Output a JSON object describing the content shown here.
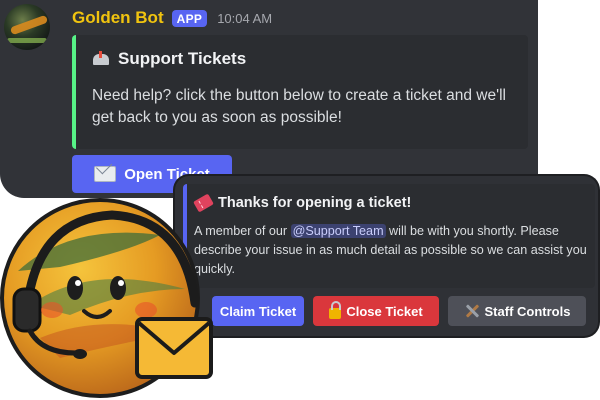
{
  "message": {
    "bot_name": "Golden Bot",
    "badge": "APP",
    "timestamp": "10:04 AM"
  },
  "embed1": {
    "title": "Support Tickets",
    "icon": "mailbox-icon",
    "description": "Need help? click the button below to create a ticket and we'll get back to you as soon as possible!",
    "accent_color": "#57f287"
  },
  "open_ticket_button": {
    "label": "Open Ticket",
    "icon": "envelope-icon",
    "color": "#5865f2"
  },
  "embed2": {
    "title": "Thanks for opening a ticket!",
    "icon": "ticket-icon",
    "desc_prefix": "A member of our ",
    "mention": "@Support Team",
    "desc_suffix": " will be with you shortly. Please describe your issue in as much detail as possible so we can assist you quickly.",
    "accent_color": "#5865f2"
  },
  "buttons": [
    {
      "label": "Claim Ticket",
      "color": "#5865f2"
    },
    {
      "label": "Close Ticket",
      "icon": "lock-icon",
      "color": "#da373c"
    },
    {
      "label": "Staff Controls",
      "icon": "tools-icon",
      "color": "#4e5058"
    }
  ]
}
